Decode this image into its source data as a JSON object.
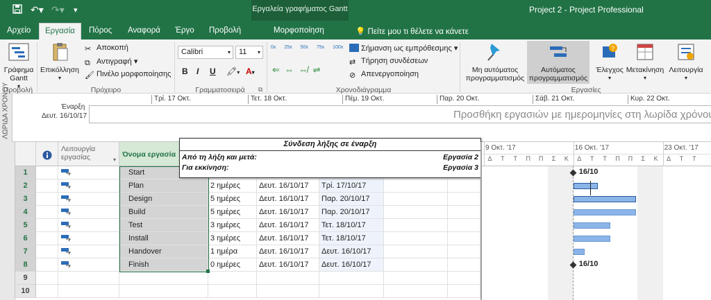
{
  "title_bar": {
    "contextual_title": "Εργαλεία γραφήματος Gantt",
    "app_title": "Project 2  -  Project Professional"
  },
  "tabs": [
    "Αρχείο",
    "Εργασία",
    "Πόρος",
    "Αναφορά",
    "Έργο",
    "Προβολή"
  ],
  "contextual_tab": "Μορφοποίηση",
  "tell_me": "Πείτε μου τι θέλετε να κάνετε",
  "ribbon": {
    "view": {
      "button": "Γράφημα Gantt",
      "group": "Προβολή"
    },
    "clipboard": {
      "paste": "Επικόλληση",
      "cut": "Αποκοπή",
      "copy": "Αντιγραφή",
      "format_painter": "Πινέλο μορφοποίησης",
      "group": "Πρόχειρο"
    },
    "font": {
      "name": "Calibri",
      "size": "11",
      "group": "Γραμματοσειρά"
    },
    "schedule": {
      "percents": [
        "0x",
        "25x",
        "50x",
        "75x",
        "100x"
      ],
      "mark_on_track": "Σήμανση ως εμπρόθεσμης",
      "respect_links": "Τήρηση συνδέσεων",
      "inactivate": "Απενεργοποίηση",
      "group": "Χρονοδιάγραμμα"
    },
    "tasks": {
      "manual": "Μη αυτόματος προγραμματισμός",
      "auto": "Αυτόματος προγραμματισμός",
      "inspect": "Έλεγχος",
      "move": "Μετακίνηση",
      "mode": "Λειτουργία",
      "group": "Εργασίες"
    }
  },
  "timeline": {
    "side_label": "ΛΩΡΙΔΑ ΧΡΟΝΟΥ",
    "start_label": "Έναρξη",
    "start_date": "Δευτ. 16/10/17",
    "dates": [
      "Τρί. 17 Οκτ.",
      "Τετ. 18 Οκτ.",
      "Πέμ. 19 Οκτ.",
      "Παρ. 20 Οκτ.",
      "Σάβ. 21 Οκτ.",
      "Κυρ. 22 Οκτ."
    ],
    "placeholder": "Προσθήκη εργασιών με ημερομηνίες στη λωρίδα χρόνου"
  },
  "sheet": {
    "headers": {
      "mode": "Λειτουργία εργασίας",
      "name": "Όνομα εργασία"
    },
    "rows": [
      {
        "n": "1",
        "name": "Start",
        "duration": "",
        "start": "",
        "finish": ""
      },
      {
        "n": "2",
        "name": "Plan",
        "duration": "2 ημέρες",
        "start": "Δευτ. 16/10/17",
        "finish": "Τρί. 17/10/17"
      },
      {
        "n": "3",
        "name": "Design",
        "duration": "5 ημέρες",
        "start": "Δευτ. 16/10/17",
        "finish": "Παρ. 20/10/17"
      },
      {
        "n": "4",
        "name": "Build",
        "duration": "5 ημέρες",
        "start": "Δευτ. 16/10/17",
        "finish": "Παρ. 20/10/17"
      },
      {
        "n": "5",
        "name": "Test",
        "duration": "3 ημέρες",
        "start": "Δευτ. 16/10/17",
        "finish": "Τετ. 18/10/17"
      },
      {
        "n": "6",
        "name": "Install",
        "duration": "3 ημέρες",
        "start": "Δευτ. 16/10/17",
        "finish": "Τετ. 18/10/17"
      },
      {
        "n": "7",
        "name": "Handover",
        "duration": "1 ημέρα",
        "start": "Δευτ. 16/10/17",
        "finish": "Δευτ. 16/10/17"
      },
      {
        "n": "8",
        "name": "Finish",
        "duration": "0 ημέρες",
        "start": "Δευτ. 16/10/17",
        "finish": "Δευτ. 16/10/17"
      },
      {
        "n": "9",
        "name": "",
        "duration": "",
        "start": "",
        "finish": ""
      },
      {
        "n": "10",
        "name": "",
        "duration": "",
        "start": "",
        "finish": ""
      }
    ]
  },
  "tooltip": {
    "title": "Σύνδεση λήξης σε έναρξη",
    "from_label": "Από τη λήξη και μετά:",
    "from_task": "Εργασία 2",
    "to_label": "Για εκκίνηση:",
    "to_task": "Εργασία 3"
  },
  "gantt": {
    "weeks": [
      "9 Οκτ. '17",
      "16 Οκτ. '17",
      "23 Οκτ. '17"
    ],
    "days": [
      "Δ",
      "Τ",
      "Τ",
      "Π",
      "Π",
      "Σ",
      "Κ",
      "Δ",
      "Τ",
      "Τ",
      "Π",
      "Π",
      "Σ",
      "Κ",
      "Δ",
      "Τ",
      "Τ"
    ],
    "milestone_start_label": "16/10",
    "milestone_finish_label": "16/10"
  }
}
